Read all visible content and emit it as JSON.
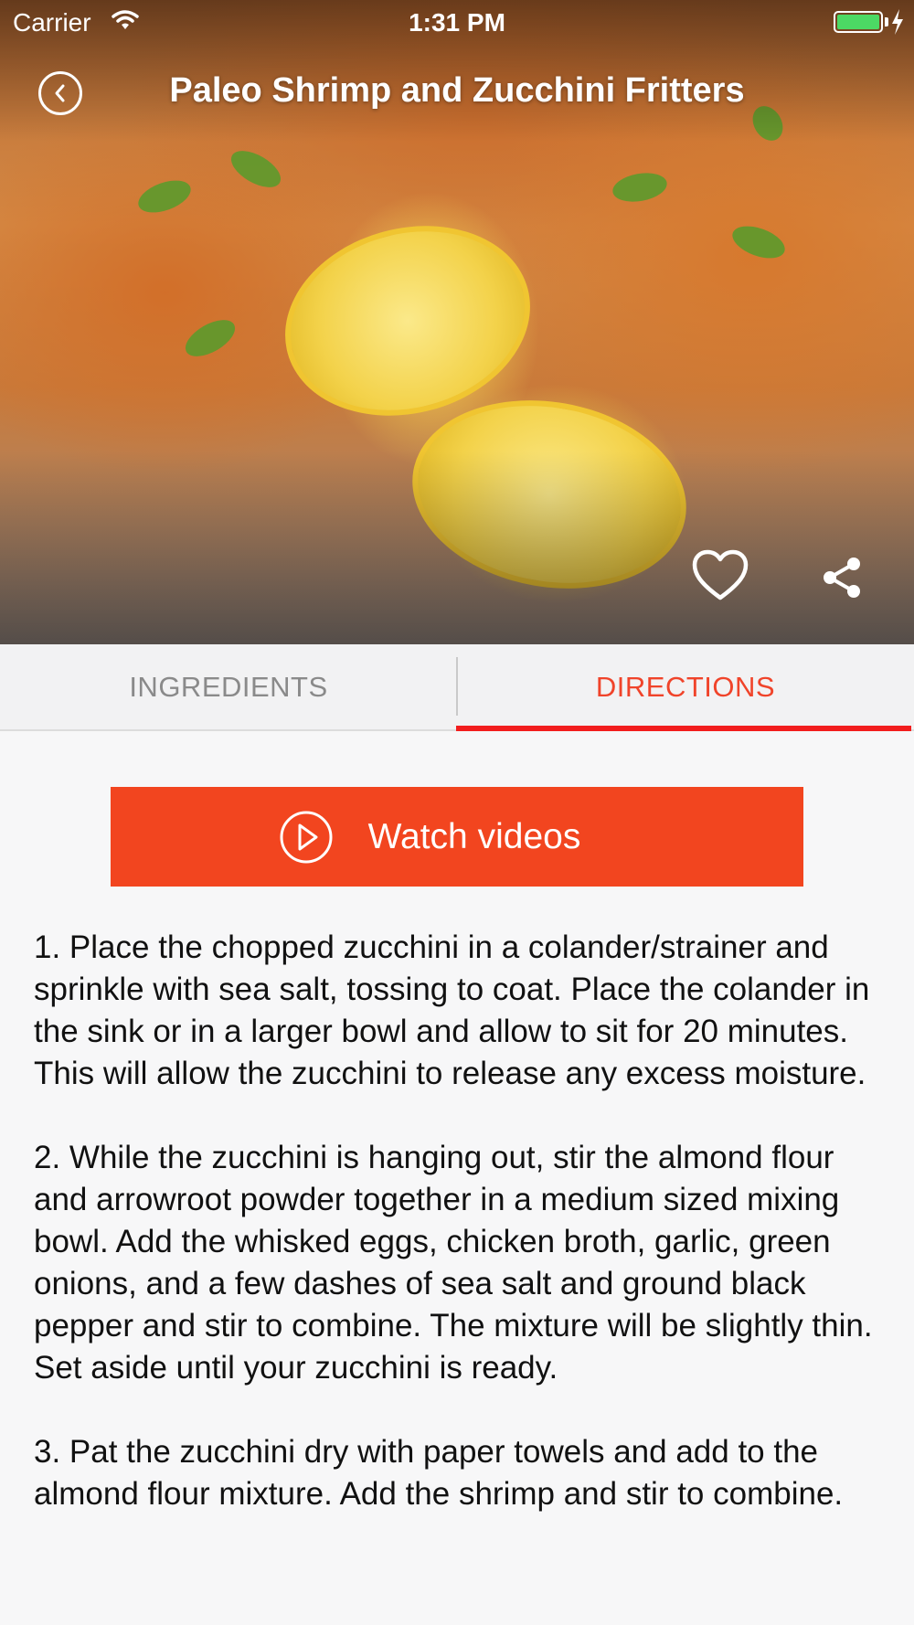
{
  "status_bar": {
    "carrier": "Carrier",
    "time": "1:31 PM"
  },
  "header": {
    "title": "Paleo Shrimp and Zucchini Fritters"
  },
  "tabs": [
    {
      "label": "INGREDIENTS",
      "active": false
    },
    {
      "label": "DIRECTIONS",
      "active": true
    }
  ],
  "watch_button": {
    "label": "Watch videos"
  },
  "directions": [
    "1. Place the chopped zucchini in a colander/strainer and sprinkle with sea salt, tossing to coat. Place the colander in the sink or in a larger bowl and allow to sit for 20 minutes. This will allow the zucchini to release any excess moisture.",
    "2. While the zucchini is hanging out, stir the almond flour and arrowroot powder together in a medium sized mixing bowl. Add the whisked eggs, chicken broth, garlic, green onions, and a few dashes of sea salt and ground black pepper and stir to combine. The mixture will be slightly thin. Set aside until your zucchini is ready.",
    "3. Pat the zucchini dry with paper towels and add to the almond flour mixture. Add the shrimp and stir to combine."
  ],
  "colors": {
    "accent": "#f2451f",
    "active_tab": "#f0442a",
    "tab_underline": "#f21d1d",
    "battery": "#4cd964"
  },
  "icons": {
    "back": "chevron-left-circle-icon",
    "favorite": "heart-outline-icon",
    "share": "share-icon",
    "play": "play-circle-icon"
  }
}
